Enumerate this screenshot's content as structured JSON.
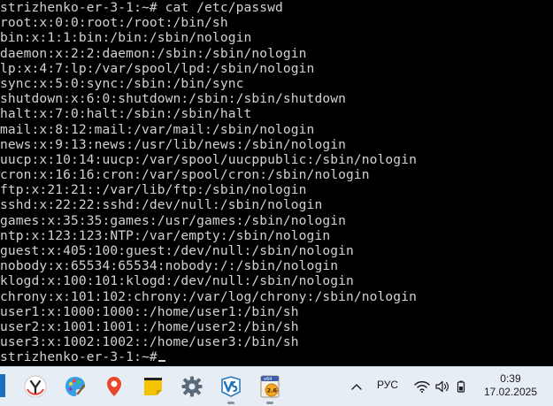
{
  "terminal": {
    "lines": [
      "strizhenko-er-3-1:~# cat /etc/passwd",
      "root:x:0:0:root:/root:/bin/sh",
      "bin:x:1:1:bin:/bin:/sbin/nologin",
      "daemon:x:2:2:daemon:/sbin:/sbin/nologin",
      "lp:x:4:7:lp:/var/spool/lpd:/sbin/nologin",
      "sync:x:5:0:sync:/sbin:/bin/sync",
      "shutdown:x:6:0:shutdown:/sbin:/sbin/shutdown",
      "halt:x:7:0:halt:/sbin:/sbin/halt",
      "mail:x:8:12:mail:/var/mail:/sbin/nologin",
      "news:x:9:13:news:/usr/lib/news:/sbin/nologin",
      "uucp:x:10:14:uucp:/var/spool/uucppublic:/sbin/nologin",
      "cron:x:16:16:cron:/var/spool/cron:/sbin/nologin",
      "ftp:x:21:21::/var/lib/ftp:/sbin/nologin",
      "sshd:x:22:22:sshd:/dev/null:/sbin/nologin",
      "games:x:35:35:games:/usr/games:/sbin/nologin",
      "ntp:x:123:123:NTP:/var/empty:/sbin/nologin",
      "guest:x:405:100:guest:/dev/null:/sbin/nologin",
      "nobody:x:65534:65534:nobody:/:/sbin/nologin",
      "klogd:x:100:101:klogd:/dev/null:/sbin/nologin",
      "chrony:x:101:102:chrony:/var/log/chrony:/sbin/nologin",
      "user1:x:1000:1000::/home/user1:/bin/sh",
      "user2:x:1001:1001::/home/user2:/bin/sh",
      "user3:x:1002:1002::/home/user3:/bin/sh"
    ],
    "prompt": "strizhenko-er-3-1:~#"
  },
  "taskbar": {
    "apps": [
      {
        "name": "yandex-browser-icon",
        "color": "#ffffff"
      },
      {
        "name": "paint-icon",
        "color": "#3aa0e6"
      },
      {
        "name": "maps-icon",
        "color": "#e8472a"
      },
      {
        "name": "sticky-notes-icon",
        "color": "#f5c400"
      },
      {
        "name": "settings-icon",
        "color": "#5a6a7a"
      },
      {
        "name": "virtualbox-icon",
        "color": "#1e73be"
      },
      {
        "name": "app-badge-icon",
        "badge": "2.6",
        "label": "x64"
      }
    ],
    "tray": {
      "language": "РУС"
    },
    "clock": {
      "time": "0:39",
      "date": "17.02.2025"
    }
  },
  "colors": {
    "terminal_bg": "#000000",
    "terminal_fg": "#d2d2d2",
    "taskbar_bg": "#e6edf5"
  }
}
